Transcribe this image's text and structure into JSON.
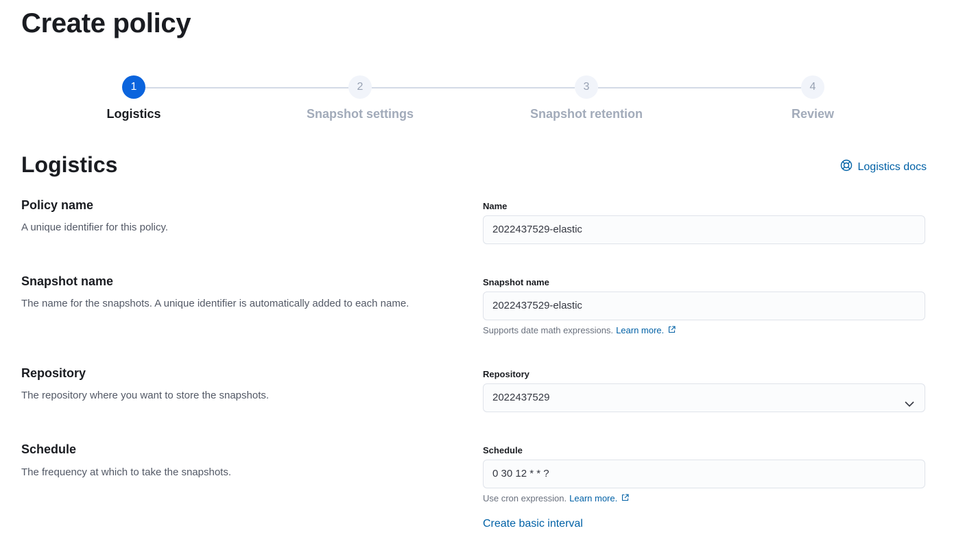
{
  "page": {
    "title": "Create policy"
  },
  "stepper": {
    "steps": [
      {
        "number": "1",
        "label": "Logistics"
      },
      {
        "number": "2",
        "label": "Snapshot settings"
      },
      {
        "number": "3",
        "label": "Snapshot retention"
      },
      {
        "number": "4",
        "label": "Review"
      }
    ]
  },
  "section": {
    "title": "Logistics",
    "docs_link": "Logistics docs"
  },
  "fields": {
    "policy_name": {
      "title": "Policy name",
      "description": "A unique identifier for this policy.",
      "label": "Name",
      "value": "2022437529-elastic"
    },
    "snapshot_name": {
      "title": "Snapshot name",
      "description": "The name for the snapshots. A unique identifier is automatically added to each name.",
      "label": "Snapshot name",
      "value": "2022437529-elastic",
      "help_text": "Supports date math expressions.",
      "help_link": "Learn more."
    },
    "repository": {
      "title": "Repository",
      "description": "The repository where you want to store the snapshots.",
      "label": "Repository",
      "value": "2022437529"
    },
    "schedule": {
      "title": "Schedule",
      "description": "The frequency at which to take the snapshots.",
      "label": "Schedule",
      "value": "0 30 12 * * ?",
      "help_text": "Use cron expression.",
      "help_link": "Learn more.",
      "basic_interval_link": "Create basic interval"
    }
  },
  "colors": {
    "accent": "#0b64dd",
    "link": "#0061a6",
    "inactive_step": "#a2abba"
  },
  "icons": {
    "docs": "lifebuoy-icon",
    "external": "popout-icon",
    "select": "chevron-down-icon"
  }
}
